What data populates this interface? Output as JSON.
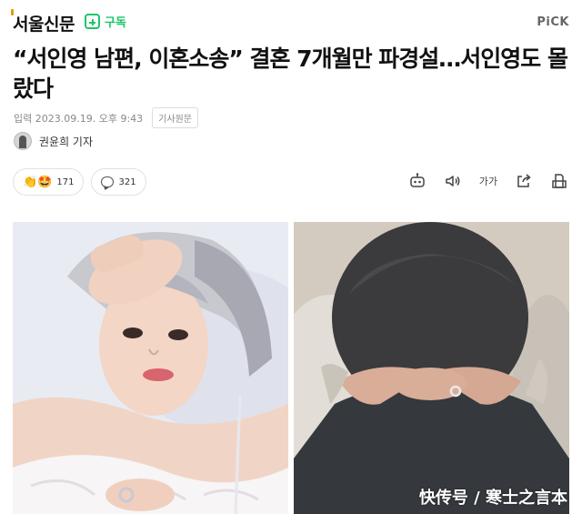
{
  "header": {
    "publisher": "서울신문",
    "subscribe_label": "구독",
    "pick_label": "PiCK"
  },
  "article": {
    "headline": "“서인영 남편, 이혼소송” 결혼 7개월만 파경설…서인영도 몰랐다",
    "meta_label": "입력",
    "date": "2023.09.19. 오후 9:43",
    "original_button": "기사원문",
    "reporter": "권윤희 기자"
  },
  "reactions": {
    "emoji": "👏🤩",
    "like_count": "171",
    "comment_count": "321"
  },
  "tools": {
    "font_size_label": "가가"
  },
  "watermark": "快传号 / 寒士之言本"
}
